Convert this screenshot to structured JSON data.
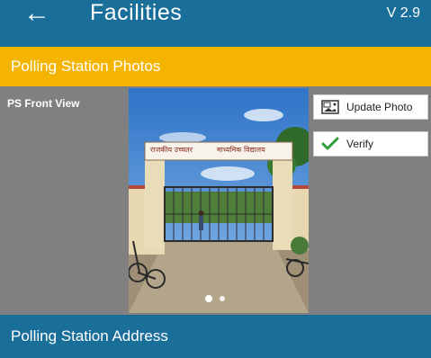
{
  "header": {
    "back_icon": "arrow-left-icon",
    "title": "Facilities",
    "version": "V 2.9"
  },
  "section": {
    "title": "Polling Station Photos"
  },
  "photo": {
    "label": "PS Front View",
    "gate_sign_left": "राजकीय उच्चतर",
    "gate_sign_right": "माध्यमिक विद्यालय",
    "carousel_pages": 2,
    "carousel_active_index": 0
  },
  "actions": {
    "update_photo": {
      "label": "Update Photo",
      "icon": "image-icon"
    },
    "verify": {
      "label": "Verify",
      "icon": "checkmark-icon",
      "color": "#2e9e3e"
    }
  },
  "footer": {
    "title": "Polling Station Address"
  },
  "colors": {
    "header": "#1a6e9a",
    "section_bar": "#f4b400",
    "panel": "#808080"
  }
}
